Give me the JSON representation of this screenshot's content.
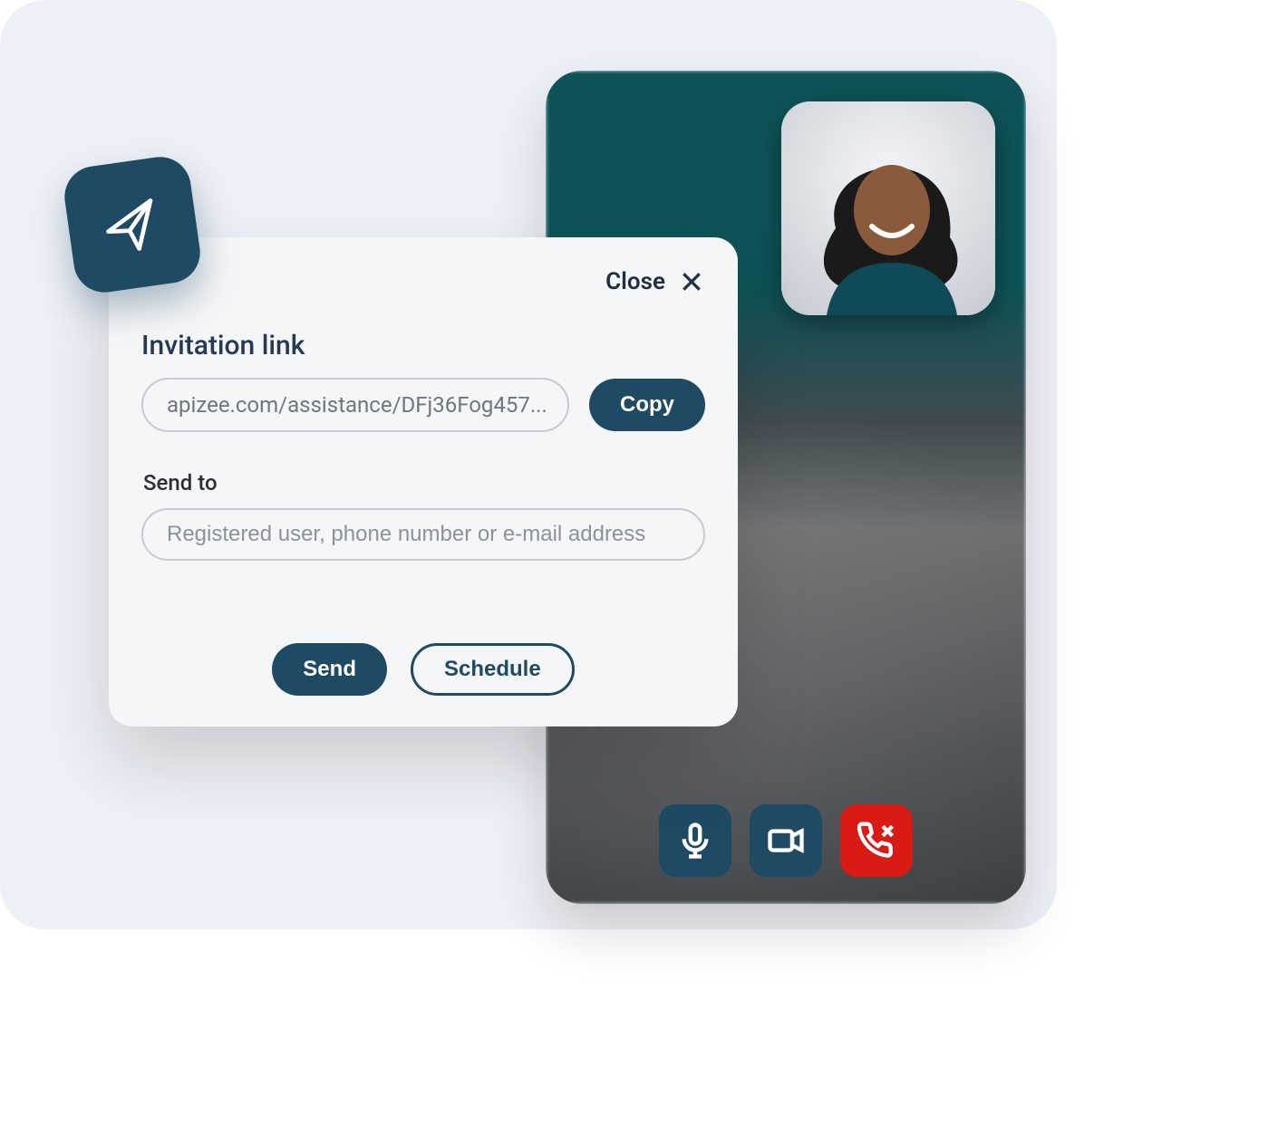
{
  "colors": {
    "accent": "#1f4a63",
    "danger": "#da1a14",
    "canvas_bg": "#eef0f7",
    "modal_bg": "#f5f6f8",
    "text_dark": "#203043"
  },
  "modal": {
    "close_label": "Close",
    "title": "Invitation link",
    "link_value": "apizee.com/assistance/DFj36Fog457...",
    "copy_label": "Copy",
    "send_to_label": "Send to",
    "send_to_placeholder": "Registered user, phone number or e-mail address",
    "send_label": "Send",
    "schedule_label": "Schedule"
  },
  "badge": {
    "icon": "paper-plane-icon"
  },
  "video": {
    "pip_description": "Self-view thumbnail",
    "controls": {
      "mic": "microphone-icon",
      "camera": "camera-icon",
      "hangup": "hangup-icon"
    }
  }
}
